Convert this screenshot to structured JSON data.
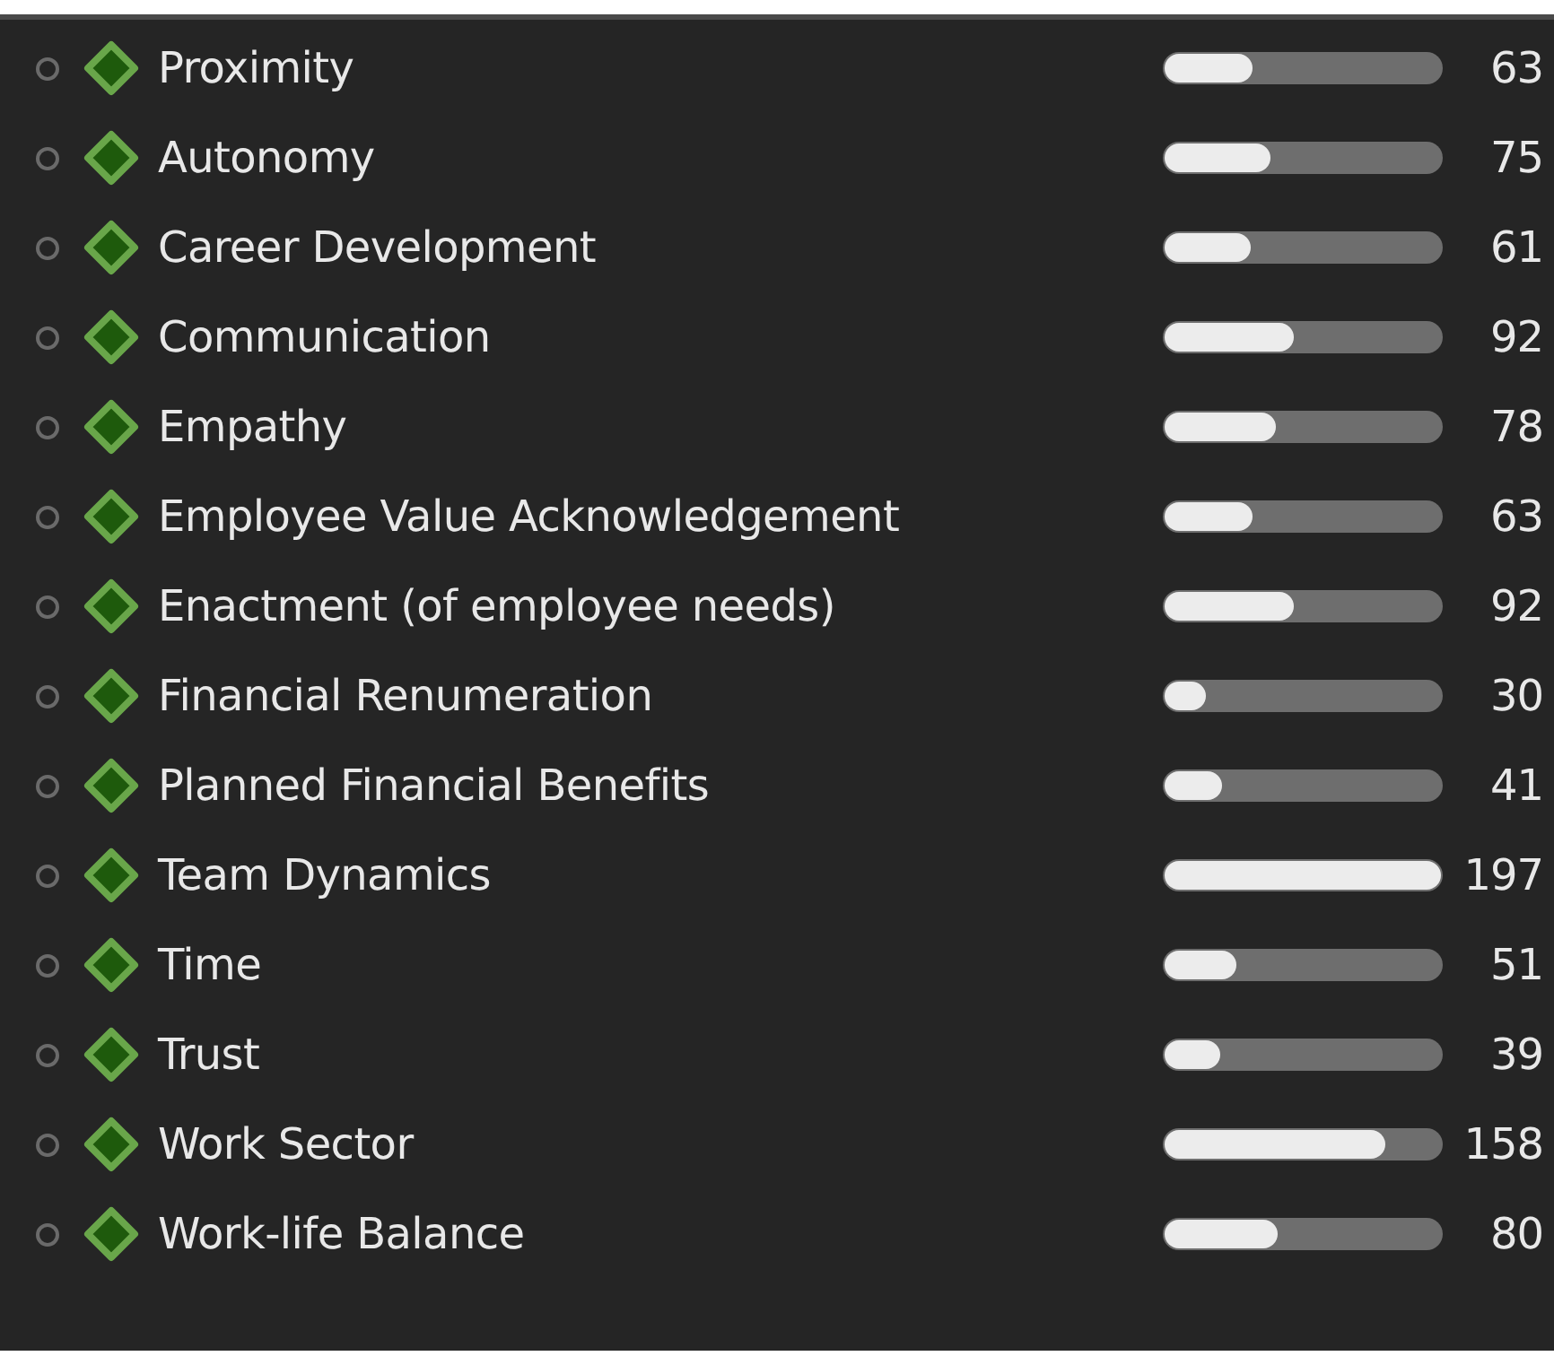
{
  "items": [
    {
      "selected": false,
      "label": "Proximity",
      "level": 0.32,
      "value": "63"
    },
    {
      "selected": false,
      "label": "Autonomy",
      "level": 0.38,
      "value": "75"
    },
    {
      "selected": false,
      "label": "Career Development",
      "level": 0.31,
      "value": "61"
    },
    {
      "selected": false,
      "label": "Communication",
      "level": 0.47,
      "value": "92"
    },
    {
      "selected": false,
      "label": "Empathy",
      "level": 0.4,
      "value": "78"
    },
    {
      "selected": false,
      "label": "Employee Value Acknowledgement",
      "level": 0.32,
      "value": "63"
    },
    {
      "selected": false,
      "label": "Enactment (of employee needs)",
      "level": 0.47,
      "value": "92"
    },
    {
      "selected": false,
      "label": "Financial Renumeration",
      "level": 0.15,
      "value": "30"
    },
    {
      "selected": false,
      "label": "Planned Financial Benefits",
      "level": 0.21,
      "value": "41"
    },
    {
      "selected": false,
      "label": "Team Dynamics",
      "level": 1,
      "value": "197"
    },
    {
      "selected": false,
      "label": "Time",
      "level": 0.26,
      "value": "51"
    },
    {
      "selected": false,
      "label": "Trust",
      "level": 0.2,
      "value": "39"
    },
    {
      "selected": false,
      "label": "Work Sector",
      "level": 0.8,
      "value": "158"
    },
    {
      "selected": false,
      "label": "Work-life Balance",
      "level": 0.41,
      "value": "80"
    }
  ]
}
